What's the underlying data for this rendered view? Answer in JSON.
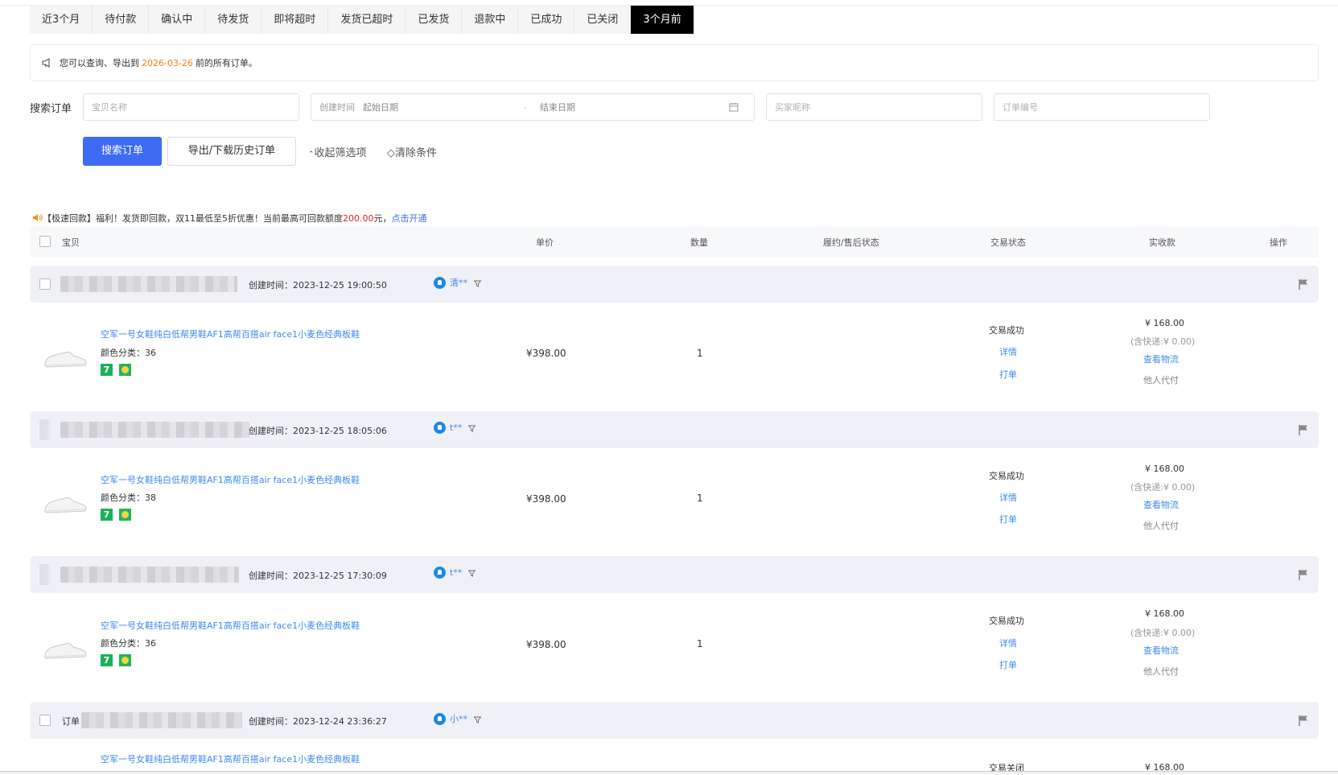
{
  "tabs": [
    "近3个月",
    "待付款",
    "确认中",
    "待发货",
    "即将超时",
    "发货已超时",
    "已发货",
    "退款中",
    "已成功",
    "已关闭",
    "3个月前"
  ],
  "active_tab_index": 10,
  "notice": {
    "prefix": "您可以查询、导出到",
    "date": "2026-03-26",
    "suffix": "前的所有订单。",
    "date_color": "#ff7a1a"
  },
  "search": {
    "label": "搜索订单",
    "item_placeholder": "宝贝名称",
    "date_label": "创建时间",
    "date_start": "起始日期",
    "date_sep": "-",
    "date_end": "结束日期",
    "buyer_placeholder": "买家昵称",
    "order_placeholder": "订单编号",
    "search_button": "搜索订单",
    "export_button": "导出/下载历史订单",
    "collapse_link": "收起筛选项",
    "clear_link": "清除条件",
    "primary_color": "#3d6bf4"
  },
  "promo": {
    "text": "【极速回款】福利！发货即回款，双11最低至5折优惠！当前最高可回款额度",
    "amount": "200.00",
    "unit": "元，",
    "link": "点击开通"
  },
  "table_header": {
    "item": "宝贝",
    "unit_price": "单价",
    "quantity": "数量",
    "fulfillment": "履约/售后状态",
    "trade_status": "交易状态",
    "received": "实收款",
    "action": "操作"
  },
  "orders": [
    {
      "created_label": "创建时间：",
      "created": "2023-12-25 19:00:50",
      "buyer": "清**",
      "title": "空军一号女鞋纯白低帮男鞋AF1高帮百搭air face1小麦色经典板鞋",
      "variant": "颜色分类：36",
      "badge": "7",
      "price": "¥398.00",
      "qty": "1",
      "status": "交易成功",
      "detail": "详情",
      "print": "打单",
      "amount": "¥ 168.00",
      "shipping": "(含快递:¥ 0.00)",
      "logistics": "查看物流",
      "paid_by": "他人代付"
    },
    {
      "created_label": "创建时间：",
      "created": "2023-12-25 18:05:06",
      "buyer": "t**",
      "title": "空军一号女鞋纯白低帮男鞋AF1高帮百搭air face1小麦色经典板鞋",
      "variant": "颜色分类：38",
      "badge": "7",
      "price": "¥398.00",
      "qty": "1",
      "status": "交易成功",
      "detail": "详情",
      "print": "打单",
      "amount": "¥ 168.00",
      "shipping": "(含快递:¥ 0.00)",
      "logistics": "查看物流",
      "paid_by": "他人代付"
    },
    {
      "created_label": "创建时间：",
      "created": "2023-12-25 17:30:09",
      "buyer": "t**",
      "title": "空军一号女鞋纯白低帮男鞋AF1高帮百搭air face1小麦色经典板鞋",
      "variant": "颜色分类：36",
      "badge": "7",
      "price": "¥398.00",
      "qty": "1",
      "status": "交易成功",
      "detail": "详情",
      "print": "打单",
      "amount": "¥ 168.00",
      "shipping": "(含快递:¥ 0.00)",
      "logistics": "查看物流",
      "paid_by": "他人代付"
    },
    {
      "created_label": "创建时间：",
      "created": "2023-12-24 23:36:27",
      "buyer": "小**",
      "order_prefix": "订单",
      "title": "空军一号女鞋纯白低帮男鞋AF1高帮百搭air face1小麦色经典板鞋",
      "status": "交易关闭",
      "amount": "¥ 168.00"
    }
  ],
  "icons": {
    "notice": "megaphone-icon",
    "promo": "speaker-icon",
    "calendar": "calendar-icon",
    "buyer": "chat-icon",
    "filter": "filter-icon",
    "flag": "flag-icon"
  }
}
